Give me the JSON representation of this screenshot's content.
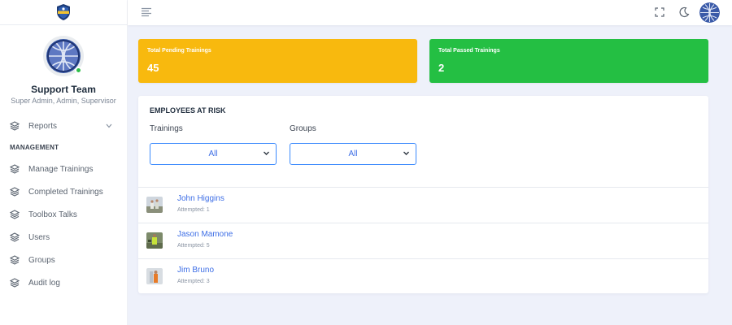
{
  "brand": {
    "logo_icon": "allsafe-shield-logo"
  },
  "profile": {
    "name": "Support Team",
    "roles": "Super Admin, Admin, Supervisor",
    "status_color": "#2fbe49"
  },
  "sidebar": {
    "reports": {
      "label": "Reports",
      "icon": "layers-icon",
      "expand_icon": "chevron-down-icon"
    },
    "section_title": "MANAGEMENT",
    "items": [
      {
        "label": "Manage Trainings",
        "icon": "layers-icon"
      },
      {
        "label": "Completed Trainings",
        "icon": "layers-icon"
      },
      {
        "label": "Toolbox Talks",
        "icon": "layers-icon"
      },
      {
        "label": "Users",
        "icon": "layers-icon"
      },
      {
        "label": "Groups",
        "icon": "layers-icon"
      },
      {
        "label": "Audit log",
        "icon": "layers-icon"
      }
    ]
  },
  "topbar": {
    "menu_icon": "hamburger-menu-icon",
    "fullscreen_icon": "fullscreen-icon",
    "theme_icon": "moon-icon"
  },
  "stats": {
    "pending": {
      "label": "Total Pending Trainings",
      "value": "45",
      "color": "#f8b90e"
    },
    "passed": {
      "label": "Total Passed Trainings",
      "value": "2",
      "color": "#24bf43"
    }
  },
  "at_risk": {
    "title": "EMPLOYEES AT RISK",
    "trainings_label": "Trainings",
    "trainings_selected": "All",
    "groups_label": "Groups",
    "groups_selected": "All",
    "employees": [
      {
        "name": "John Higgins",
        "attempts": "Attempted: 1"
      },
      {
        "name": "Jason Mamone",
        "attempts": "Attempted: 5"
      },
      {
        "name": "Jim Bruno",
        "attempts": "Attempted: 3"
      }
    ]
  },
  "colors": {
    "accent": "#3d6ee6",
    "select_border": "#3d8bfd",
    "page_bg": "#eef1fa"
  }
}
